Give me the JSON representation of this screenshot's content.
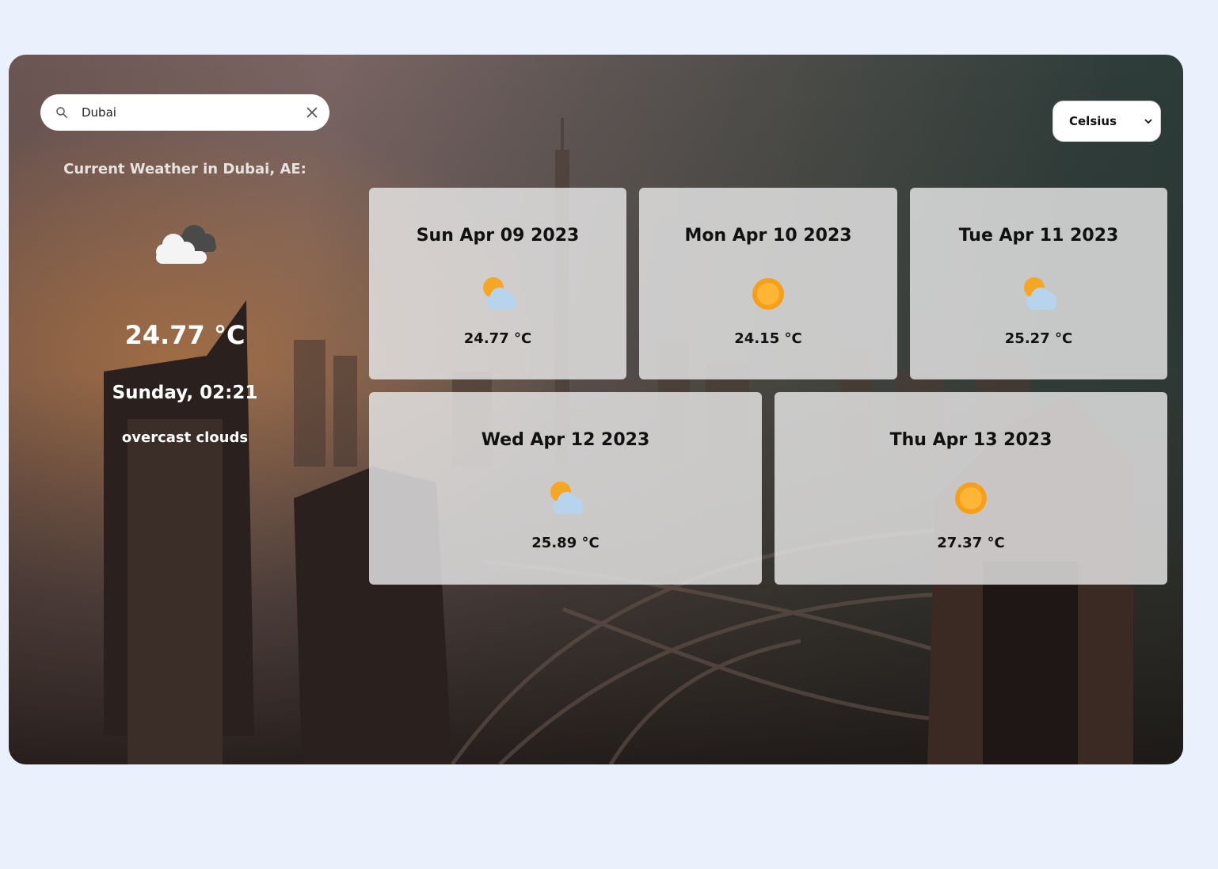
{
  "search": {
    "value": "Dubai",
    "placeholder": "Search city"
  },
  "unit_select": {
    "selected": "Celsius"
  },
  "current": {
    "title": "Current Weather in Dubai, AE:",
    "temperature": "24.77 °C",
    "datetime": "Sunday, 02:21",
    "description": "overcast clouds",
    "icon": "overcast-clouds-icon"
  },
  "forecast": [
    {
      "date": "Sun Apr 09 2023",
      "temp": "24.77 °C",
      "icon": "partly-cloudy-icon"
    },
    {
      "date": "Mon Apr 10 2023",
      "temp": "24.15 °C",
      "icon": "sun-icon"
    },
    {
      "date": "Tue Apr 11 2023",
      "temp": "25.27 °C",
      "icon": "partly-cloudy-icon"
    },
    {
      "date": "Wed Apr 12 2023",
      "temp": "25.89 °C",
      "icon": "partly-cloudy-icon"
    },
    {
      "date": "Thu Apr 13 2023",
      "temp": "27.37 °C",
      "icon": "sun-icon"
    }
  ],
  "colors": {
    "page_bg": "#eaf0fc",
    "card_bg": "#e8e8e8",
    "text_light": "#ffffff"
  }
}
